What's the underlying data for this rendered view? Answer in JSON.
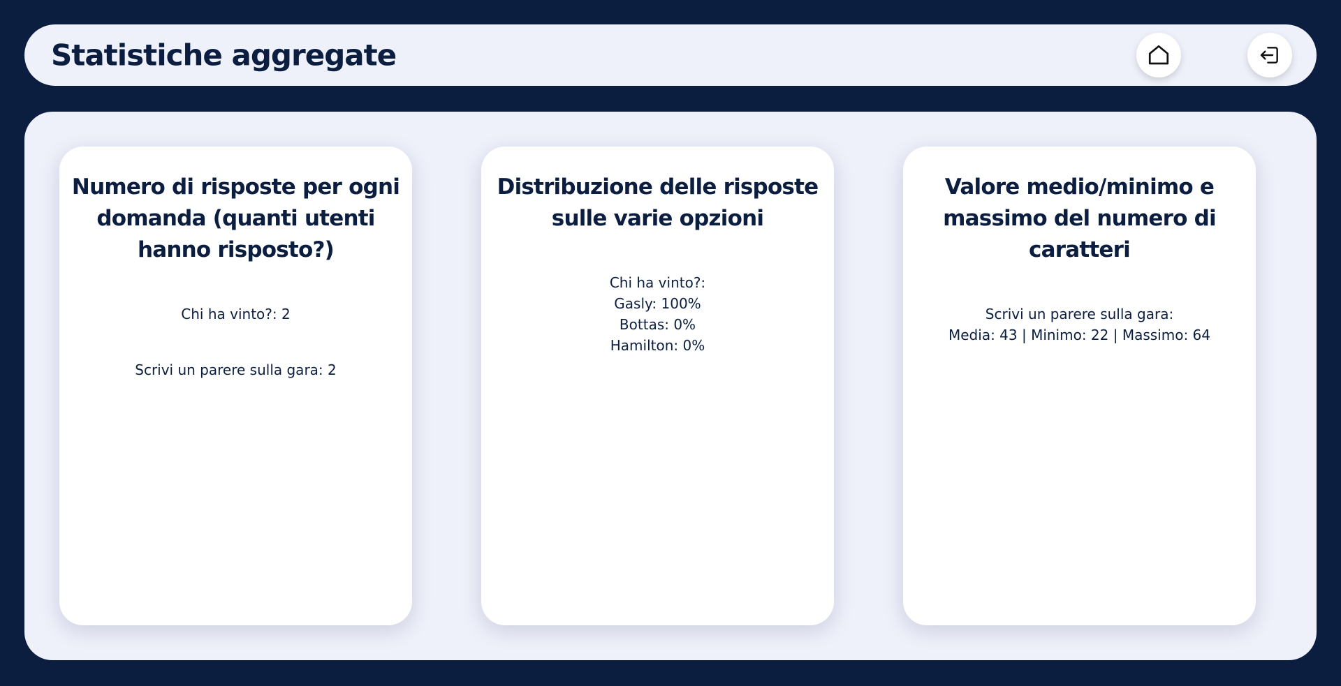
{
  "header": {
    "title": "Statistiche aggregate",
    "home_icon": "home-icon",
    "logout_icon": "logout-icon"
  },
  "cards": [
    {
      "title": "Numero di risposte per ogni domanda (quanti utenti hanno risposto?)",
      "lines": [
        "Chi ha vinto?: 2",
        "Scrivi un parere sulla gara: 2"
      ]
    },
    {
      "title": "Distribuzione delle risposte sulle varie opzioni",
      "lines": [
        "Chi ha vinto?:",
        "Gasly: 100%",
        "Bottas: 0%",
        "Hamilton: 0%"
      ]
    },
    {
      "title": "Valore medio/minimo e massimo del numero di caratteri",
      "lines": [
        "Scrivi un parere sulla gara:",
        "Media: 43 | Minimo: 22 | Massimo: 64"
      ]
    }
  ],
  "colors": {
    "background": "#0c1e40",
    "panel": "#eef0fa",
    "card": "#ffffff",
    "text": "#0c1e40"
  }
}
